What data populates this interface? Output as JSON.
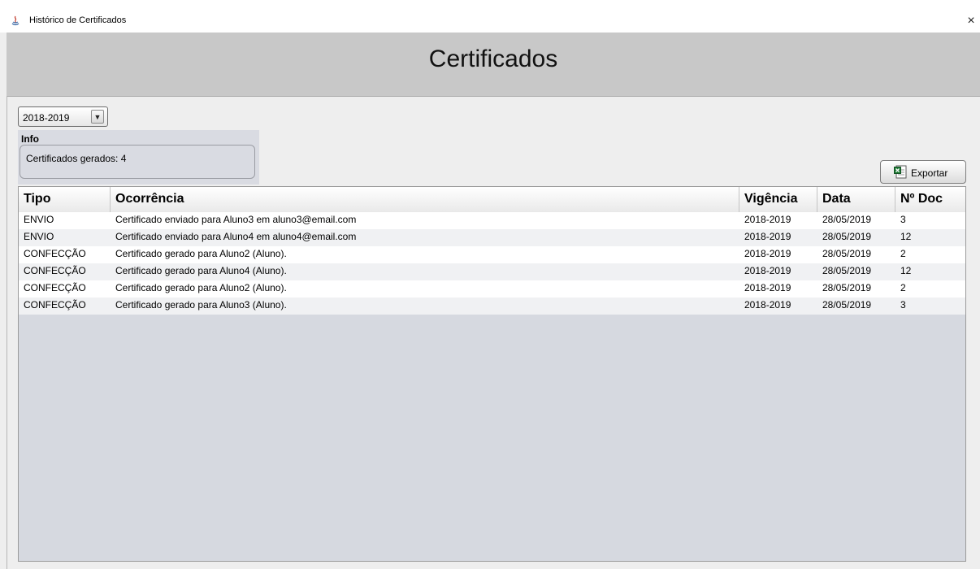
{
  "window": {
    "title": "Histórico de Certificados",
    "close_glyph": "×",
    "icon": "java-app-icon"
  },
  "banner": {
    "title": "Certificados"
  },
  "filter": {
    "selected_year": "2018-2019",
    "arrow_glyph": "▼"
  },
  "info": {
    "label": "Info",
    "text": "Certificados gerados: 4"
  },
  "toolbar": {
    "export_label": "Exportar",
    "export_icon": "excel-icon"
  },
  "table": {
    "headers": [
      "Tipo",
      "Ocorrência",
      "Vigência",
      "Data",
      "Nº Doc"
    ],
    "rows": [
      [
        "ENVIO",
        "Certificado enviado para Aluno3 em aluno3@email.com",
        "2018-2019",
        "28/05/2019",
        "3"
      ],
      [
        "ENVIO",
        "Certificado enviado para Aluno4 em aluno4@email.com",
        "2018-2019",
        "28/05/2019",
        "12"
      ],
      [
        "CONFECÇÃO",
        "Certificado gerado para Aluno2 (Aluno).",
        "2018-2019",
        "28/05/2019",
        "2"
      ],
      [
        "CONFECÇÃO",
        "Certificado gerado para Aluno4 (Aluno).",
        "2018-2019",
        "28/05/2019",
        "12"
      ],
      [
        "CONFECÇÃO",
        "Certificado gerado para Aluno2 (Aluno).",
        "2018-2019",
        "28/05/2019",
        "2"
      ],
      [
        "CONFECÇÃO",
        "Certificado gerado para Aluno3 (Aluno).",
        "2018-2019",
        "28/05/2019",
        "3"
      ]
    ]
  }
}
